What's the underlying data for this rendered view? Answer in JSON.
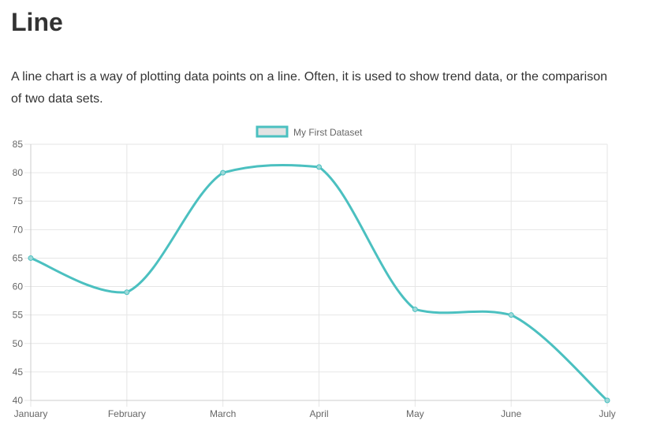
{
  "page": {
    "title": "Line",
    "description": "A line chart is a way of plotting data points on a line. Often, it is used to show trend data, or the comparison of two data sets."
  },
  "colors": {
    "line": "#4bc0c0",
    "legend_fill": "#e3e3e3",
    "grid": "#e6e6e6",
    "tick_text": "#666666"
  },
  "chart_data": {
    "type": "line",
    "categories": [
      "January",
      "February",
      "March",
      "April",
      "May",
      "June",
      "July"
    ],
    "series": [
      {
        "name": "My First Dataset",
        "values": [
          65,
          59,
          80,
          81,
          56,
          55,
          40
        ]
      }
    ],
    "y_ticks": [
      "85",
      "80",
      "75",
      "70",
      "65",
      "60",
      "55",
      "50",
      "45",
      "40"
    ],
    "ylim": [
      40,
      85
    ],
    "grid": true,
    "legend_position": "top"
  }
}
